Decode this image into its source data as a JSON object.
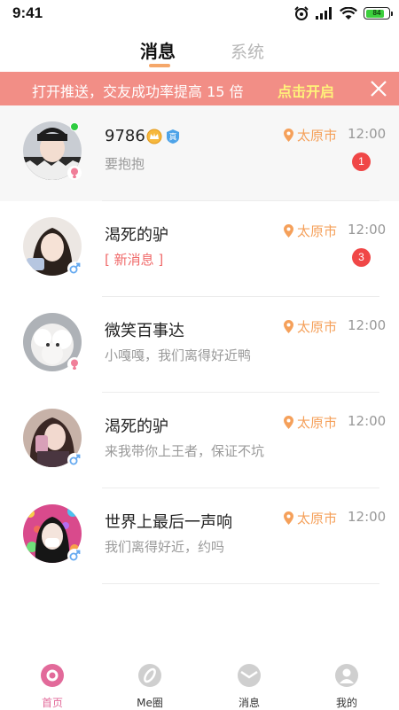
{
  "status_bar": {
    "time": "9:41",
    "battery": "84",
    "battery_level": 0.84
  },
  "tabs": [
    {
      "label": "消息",
      "active": true
    },
    {
      "label": "系统",
      "active": false
    }
  ],
  "banner": {
    "text": "打开推送，交友成功率提高 15 倍",
    "action": "点击开启"
  },
  "colors": {
    "accent_orange": "#f5a05a",
    "banner_bg": "#f28e86",
    "banner_action": "#fff27a",
    "badge_red": "#f04747",
    "nav_active": "#e26a9a"
  },
  "conversations": [
    {
      "name": "9786",
      "preview": "要抱抱",
      "location": "太原市",
      "time": "12:00",
      "unread": "1",
      "gender": "female",
      "online": true,
      "highlight": true,
      "vip": true,
      "verified": true
    },
    {
      "name": "渴死的驴",
      "preview": "[ 新消息 ]",
      "location": "太原市",
      "time": "12:00",
      "unread": "3",
      "gender": "male"
    },
    {
      "name": "微笑百事达",
      "preview": "小嘎嘎，我们离得好近鸭",
      "location": "太原市",
      "time": "12:00",
      "gender": "female"
    },
    {
      "name": "渴死的驴",
      "preview": "来我带你上王者，保证不坑",
      "location": "太原市",
      "time": "12:00",
      "gender": "male"
    },
    {
      "name": "世界上最后一声响",
      "preview": "我们离得好近，约吗",
      "location": "太原市",
      "time": "12:00",
      "gender": "male"
    }
  ],
  "bottom_nav": [
    {
      "label": "首页",
      "icon": "home-icon",
      "active": true
    },
    {
      "label": "Me圈",
      "icon": "circle-feed-icon",
      "active": false
    },
    {
      "label": "消息",
      "icon": "message-icon",
      "active": false
    },
    {
      "label": "我的",
      "icon": "profile-icon",
      "active": false
    }
  ]
}
